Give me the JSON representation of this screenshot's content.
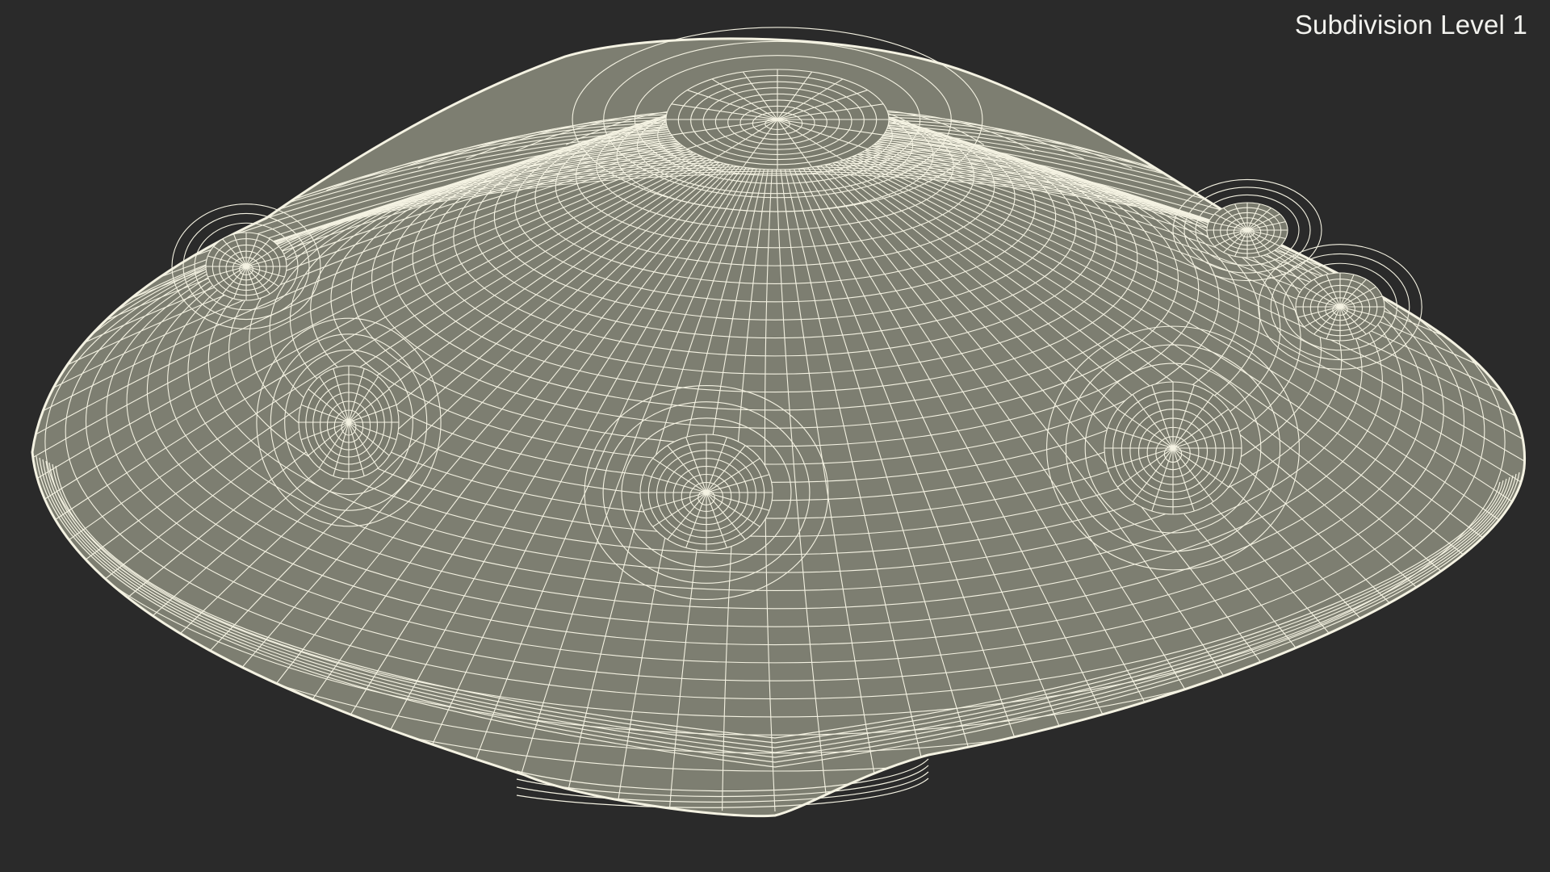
{
  "viewport": {
    "label": "Subdivision Level 1"
  },
  "colors": {
    "background": "#2a2a2a",
    "surface": "#7d7e71",
    "wire": "#f4f2e2"
  },
  "model": {
    "name": "handpan",
    "display": "wireframe",
    "subdivision_level": 1
  }
}
